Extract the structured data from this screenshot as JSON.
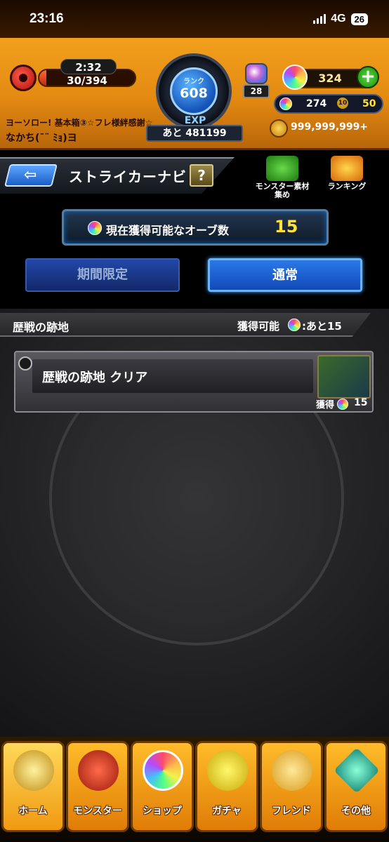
{
  "status_bar": {
    "time": "23:16",
    "network": "4G",
    "battery": "26"
  },
  "header": {
    "stamina_time": "2:32",
    "stamina_value": "30/394",
    "stamina_fraction": 0.076,
    "rank_label": "ランク",
    "rank_value": "608",
    "exp_label": "EXP",
    "exp_remaining": "あと 481199",
    "badge_value": "28",
    "orb_count": "324",
    "sub_orb_value": "274",
    "sub_orb_badge": "10",
    "sub_orb_value2": "50",
    "coins": "999,999,999+",
    "message_line1": "ヨーソロー! 基本箱③☆フレ様絆感謝☆",
    "message_line2": "なかち(¯¨ ﾐｮ)ヨ"
  },
  "titlebar": {
    "title": "ストライカーナビ",
    "help": "?",
    "side_left_label": "モンスター素材集め",
    "side_right_label": "ランキング"
  },
  "orb_summary": {
    "label": "現在獲得可能なオーブ数",
    "value": "15"
  },
  "tabs": {
    "limited": "期間限定",
    "normal": "通常"
  },
  "section": {
    "title": "歴戦の跡地",
    "get_label": "獲得可能",
    "rest": ":あと15"
  },
  "mission": {
    "label": "歴戦の跡地 クリア",
    "reward_label": "獲得",
    "reward_value": "15"
  },
  "bottom_nav": [
    {
      "label": "ホーム"
    },
    {
      "label": "モンスター"
    },
    {
      "label": "ショップ"
    },
    {
      "label": "ガチャ"
    },
    {
      "label": "フレンド"
    },
    {
      "label": "その他"
    }
  ],
  "colors": {
    "header_orange": "#e48a12",
    "accent_blue": "#2a78e8",
    "orb_yellow": "#ffe23a"
  }
}
